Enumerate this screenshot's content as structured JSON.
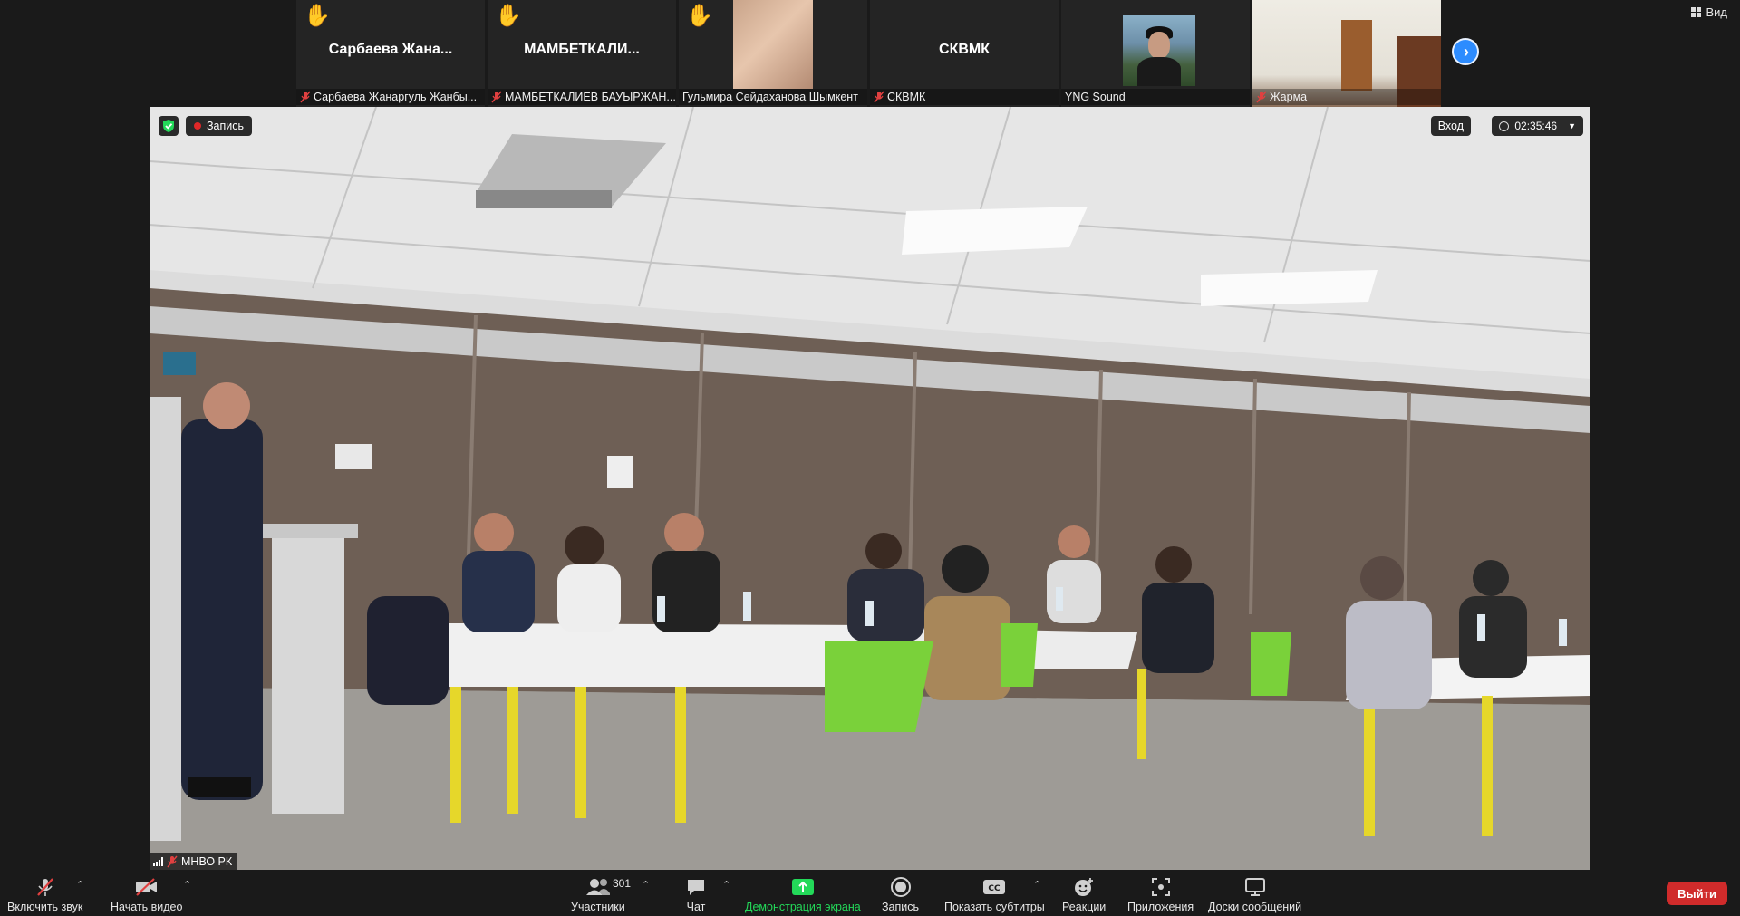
{
  "top_strip": {
    "view_label": "Вид",
    "tiles": [
      {
        "big_name": "Сарбаева  Жана...",
        "caption": "Сарбаева Жанаргуль Жанбы...",
        "hand": "✋",
        "muted": true
      },
      {
        "big_name": "МАМБЕТКАЛИ...",
        "caption": "МАМБЕТКАЛИЕВ БАУЫРЖАН...",
        "hand": "✋",
        "muted": true
      },
      {
        "big_name": "",
        "caption": "Гульмира Сейдаханова Шымкент",
        "hand": "✋",
        "muted": false
      },
      {
        "big_name": "СКВМК",
        "caption": "СКВМК",
        "hand": "",
        "muted": true
      },
      {
        "big_name": "",
        "caption": "YNG Sound",
        "hand": "",
        "muted": false
      },
      {
        "big_name": "",
        "caption": "Жарма",
        "hand": "",
        "muted": true
      }
    ]
  },
  "main_video": {
    "recording_label": "Запись",
    "enter_label": "Вход",
    "timer": "02:35:46",
    "speaker_name": "МНВО РК"
  },
  "toolbar": {
    "unmute_label": "Включить звук",
    "start_video_label": "Начать видео",
    "participants_label": "Участники",
    "participants_count": "301",
    "chat_label": "Чат",
    "share_label": "Демонстрация экрана",
    "record_label": "Запись",
    "captions_label": "Показать субтитры",
    "reactions_label": "Реакции",
    "apps_label": "Приложения",
    "whiteboards_label": "Доски сообщений",
    "leave_label": "Выйти"
  },
  "colors": {
    "accent_blue": "#2d8cff",
    "share_green": "#23d959",
    "leave_red": "#d02b2b",
    "recording_red": "#e02828"
  }
}
